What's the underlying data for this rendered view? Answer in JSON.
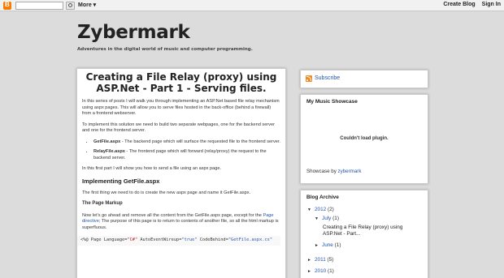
{
  "navbar": {
    "more_label": "More ▾",
    "create_blog": "Create Blog",
    "sign_in": "Sign In"
  },
  "header": {
    "title": "Zybermark",
    "description": "Adventures in the digital world of music and computer programming."
  },
  "post": {
    "title": "Creating a File Relay (proxy) using ASP.Net - Part 1 - Serving files.",
    "p1": "In this series of posts I will walk you through implementing an ASP.Net based file relay mechanism using aspx pages. This will allow you to serve files hosted in the back-office (behind a firewall) from a frontend webserver.",
    "p2": "To implement this solution we need to build two separate webpages, one for the backend server and one for the frontend server.",
    "bullets": [
      {
        "name": "GetFile.aspx",
        "text": " - The backend page which will surface the requested file to the frontend server."
      },
      {
        "name": "RelayFile.aspx",
        "text": " - The frontend page which will forward (relay/proxy) the request to the backend server."
      }
    ],
    "p3": "In this first part I will show you how to send a file using an aspx page.",
    "section_heading": "Implementing GetFile.aspx",
    "p4": "The first thing we need to do is create the new aspx page and name it GetFile.aspx.",
    "subheading": "The Page Markup",
    "p5_a": "Now let's go ahead and remove all the content from the GetFile.aspx page, except for the ",
    "p5_link": "Page directive",
    "p5_b": "; The purpose of this page is to return to contents of another file, so all the html markup is superfluous.",
    "code": {
      "c1": "<%@ Page Language=",
      "c2": "\"C#\"",
      "c3": " AutoEventWireup=",
      "c4": "\"true\"",
      "c5": " CodeBehind=",
      "c6": "\"GetFile.aspx.cs\""
    }
  },
  "sidebar": {
    "subscribe": "Subscribe",
    "music_title": "My Music Showcase",
    "plugin_msg": "Couldn't load plugin.",
    "showcase_text": "Showcase by ",
    "showcase_link": "zybermark",
    "archive_title": "Blog Archive",
    "archive": {
      "y2012": "2012",
      "y2012_count": "(2)",
      "july": "July",
      "july_count": "(1)",
      "post_link": "Creating a File Relay (proxy) using ASP.Net - Part...",
      "june": "June",
      "june_count": "(1)",
      "y2011": "2011",
      "y2011_count": "(5)",
      "y2010": "2010",
      "y2010_count": "(1)"
    }
  },
  "icons": {
    "blogger": "blogger-logo-icon",
    "search_go": "search-icon",
    "rss": "rss-feed-icon",
    "collapse": "triangle-down-icon",
    "expand": "triangle-right-icon"
  },
  "colors": {
    "background": "#dcdcdc",
    "link": "#2255aa",
    "blogger_orange": "#f57c00",
    "rss_orange": "#f08a24"
  }
}
